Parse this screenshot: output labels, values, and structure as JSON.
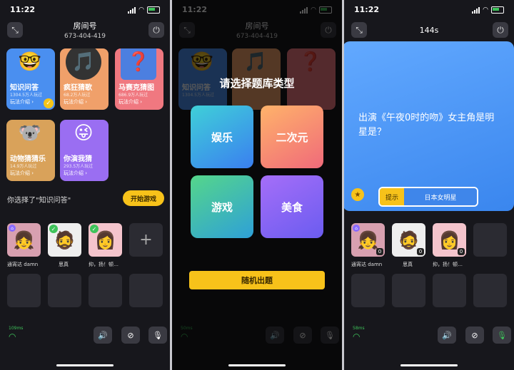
{
  "status": {
    "time": "11:22"
  },
  "room": {
    "label": "房间号",
    "number": "673-404-419"
  },
  "categories": [
    {
      "name": "知识问答",
      "count": "1304.5万人玩过",
      "intro": "玩法介绍 ›",
      "icon": "🤓",
      "color": "#4a8ff0",
      "selected": true
    },
    {
      "name": "疯狂猜歌",
      "count": "68.2万人玩过",
      "intro": "玩法介绍 ›",
      "icon": "🎵",
      "color": "#f0a06a"
    },
    {
      "name": "马赛克猜图",
      "count": "686.9万人玩过",
      "intro": "玩法介绍 ›",
      "icon": "❓",
      "color": "#f07880"
    },
    {
      "name": "动物猜猜乐",
      "count": "14.9万人玩过",
      "intro": "玩法介绍 ›",
      "icon": "🐨",
      "color": "#d9a25a"
    },
    {
      "name": "你演我猜",
      "count": "293.5万人玩过",
      "intro": "玩法介绍 ›",
      "icon": "😜",
      "color": "#9a6ef2"
    }
  ],
  "selection": {
    "text": "你选择了\"知识问答\"",
    "start_label": "开始游戏"
  },
  "players": [
    {
      "name": "通宵达 damn",
      "icon": "👧",
      "score": "0"
    },
    {
      "name": "思真",
      "icon": "🧔",
      "score": "0"
    },
    {
      "name": "抑，扬！顿…",
      "icon": "👩",
      "score": "0"
    }
  ],
  "add_seat": "+",
  "ping": {
    "p1": "109ms",
    "p2": "50ms",
    "p3": "58ms"
  },
  "overlay": {
    "title": "请选择题库类型",
    "cats": [
      "娱乐",
      "二次元",
      "游戏",
      "美食"
    ],
    "random_label": "随机出题"
  },
  "quiz": {
    "timer": "144s",
    "question": "出演《午夜0时的吻》女主角是明星是？",
    "hint_label": "提示",
    "hint_value": "日本女明星"
  },
  "colors": {
    "accent": "#f7c21a",
    "quiz_bg": "#4f9cf8",
    "ok": "#3ec35a"
  }
}
